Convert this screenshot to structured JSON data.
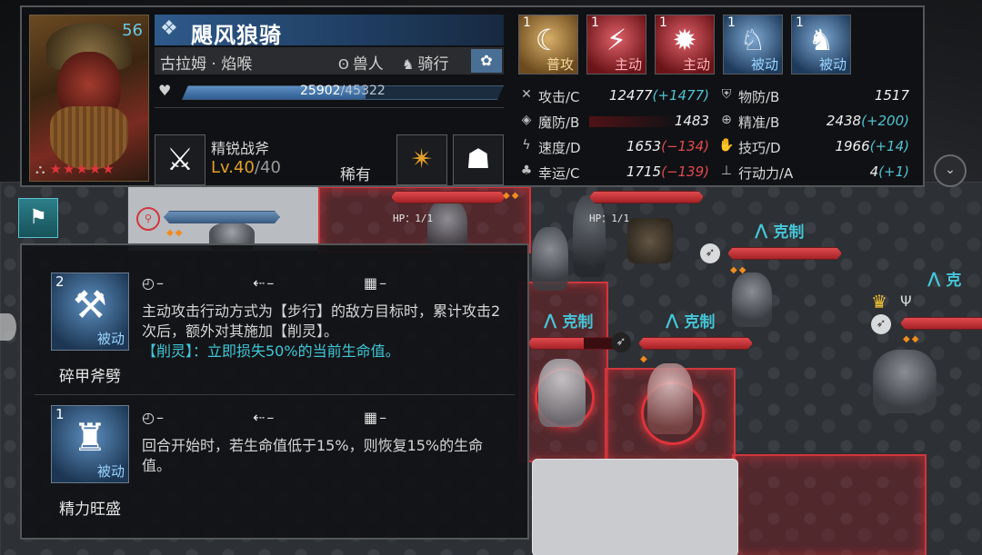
{
  "unit": {
    "level": "56",
    "name": "飓风狼骑",
    "hero": "古拉姆 · 焰喉",
    "race": "兽人",
    "movement": "骑行",
    "stars": "★★★★★",
    "hp_current": "25902",
    "hp_max": "/45322",
    "hp_fraction": 0.571
  },
  "weapon": {
    "name": "精锐战斧",
    "level_prefix": "Lv.",
    "level": "40",
    "level_max": "/40",
    "rarity": "稀有"
  },
  "skills_top": [
    {
      "count": "1",
      "type": "普攻",
      "style": "gold",
      "icon": "crescent-icon"
    },
    {
      "count": "1",
      "type": "主动",
      "style": "red",
      "icon": "claw-icon"
    },
    {
      "count": "1",
      "type": "主动",
      "style": "red",
      "icon": "burst-icon"
    },
    {
      "count": "1",
      "type": "被动",
      "style": "blue",
      "icon": "wolf-icon"
    },
    {
      "count": "1",
      "type": "被动",
      "style": "blue",
      "icon": "lion-icon"
    }
  ],
  "stats": {
    "atk": {
      "label": "攻击/C",
      "value": "12477",
      "mod": "(+1477)",
      "dir": "up"
    },
    "pdef": {
      "label": "物防/B",
      "value": "1517",
      "mod": "",
      "dir": ""
    },
    "mdef": {
      "label": "魔防/B",
      "value": "1483",
      "mod": "",
      "dir": ""
    },
    "acc": {
      "label": "精准/B",
      "value": "2438",
      "mod": "(+200)",
      "dir": "up"
    },
    "spd": {
      "label": "速度/D",
      "value": "1653",
      "mod": "(−134)",
      "dir": "down"
    },
    "skl": {
      "label": "技巧/D",
      "value": "1966",
      "mod": "(+14)",
      "dir": "up"
    },
    "luck": {
      "label": "幸运/C",
      "value": "1715",
      "mod": "(−139)",
      "dir": "down"
    },
    "move": {
      "label": "行动力/A",
      "value": "4",
      "mod": "(+1)",
      "dir": "up"
    }
  },
  "field": {
    "hp_label_1": "HP：1/1",
    "hp_label_2": "HP：1/1",
    "counter_label": "克制",
    "counter_1": "克制",
    "counter_2": "克制",
    "counter_3": "克制",
    "counter_4": "克制",
    "counter_5": "克"
  },
  "skill_details": [
    {
      "count": "2",
      "type": "被动",
      "name": "碎甲斧劈",
      "cooldown": "–",
      "range": "–",
      "area": "–",
      "desc": "主动攻击行动方式为【步行】的敌方目标时，累计攻击2次后，额外对其施加【削灵】。",
      "effect": "【削灵】：立即损失50%的当前生命值。"
    },
    {
      "count": "1",
      "type": "被动",
      "name": "精力旺盛",
      "cooldown": "–",
      "range": "–",
      "area": "–",
      "desc": "回合开始时，若生命值低于15%，则恢复15%的生命值。",
      "effect": ""
    }
  ],
  "colors": {
    "accent_cyan": "#3ec8d8",
    "stat_up": "#4fc3d1",
    "stat_down": "#e24a4f",
    "weapon_level": "#e2a028",
    "enemy_red": "#d0363d"
  }
}
